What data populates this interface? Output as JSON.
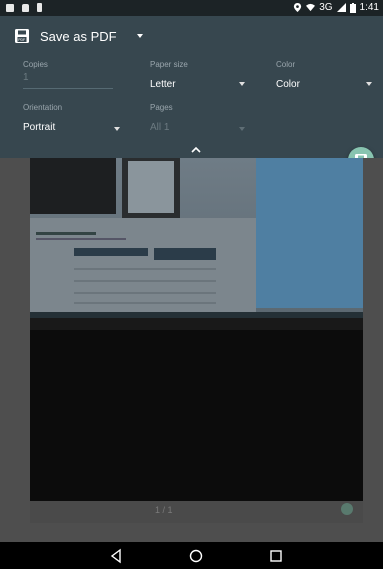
{
  "status_bar": {
    "network": "3G",
    "time": "1:41"
  },
  "printer": {
    "name": "Save as PDF"
  },
  "options": {
    "copies": {
      "label": "Copies",
      "value": "1"
    },
    "paper_size": {
      "label": "Paper size",
      "value": "Letter"
    },
    "color": {
      "label": "Color",
      "value": "Color"
    },
    "orientation": {
      "label": "Orientation",
      "value": "Portrait"
    },
    "pages": {
      "label": "Pages",
      "value": "All 1"
    }
  },
  "preview": {
    "page_indicator": "1 / 1"
  },
  "colors": {
    "panel": "#37474f",
    "accent": "#88c4b0"
  }
}
